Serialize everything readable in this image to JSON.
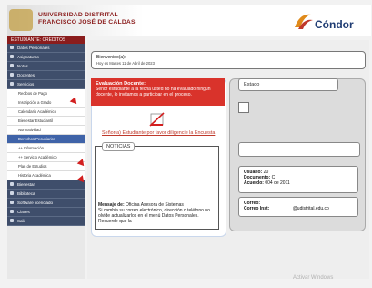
{
  "header": {
    "institution_line1": "UNIVERSIDAD DISTRITAL",
    "institution_line2": "FRANCISCO JOSÉ DE CALDAS",
    "app_name": "Cóndor"
  },
  "sidebar": {
    "title": "ESTUDIANTE: CREDITOS",
    "items": [
      {
        "label": "Datos Personales"
      },
      {
        "label": "Asignaturas"
      },
      {
        "label": "Notas"
      },
      {
        "label": "Docentes"
      },
      {
        "label": "Servicios"
      }
    ],
    "sub_items": [
      {
        "label": "Recibos de Pago"
      },
      {
        "label": "Inscripción a Grado"
      },
      {
        "label": "Calendario Académico"
      },
      {
        "label": "Bienestar Estudiantil"
      },
      {
        "label": "Normatividad"
      },
      {
        "label": "Derechos Pecuniarios",
        "active": true
      },
      {
        "label": "++ Información"
      },
      {
        "label": "++ Servicio Académico"
      },
      {
        "label": "Plan de Estudios"
      },
      {
        "label": "Historia Académica"
      }
    ],
    "bottom_items": [
      {
        "label": "Bienestar"
      },
      {
        "label": "Biblioteca"
      },
      {
        "label": "Software licenciado"
      },
      {
        "label": "Claves"
      },
      {
        "label": "Salir"
      }
    ]
  },
  "welcome": {
    "title": "Bienvenido(a):",
    "date_line": "Hoy es Martes 11 de Abril de 2023"
  },
  "evaluation": {
    "heading": "Evaluación Docente:",
    "body": "Señor estudiante a la fecha usted no ha evaluado ningún docente, lo invitamos a participar en el proceso.",
    "link": "Señor(a) Estudiante por favor diligencie la Encuesta"
  },
  "news": {
    "label": "NOTICIAS",
    "message_label": "Mensaje de:",
    "message_from": "Oficina Asesora de Sistemas",
    "message_body": "Si cambia su correo electrónico, dirección o teléfono no olvide actualizarlos en el menú Datos Personales. Recuerde que la"
  },
  "status": {
    "label": "Estado",
    "user_label": "Usuario:",
    "user_value": "20",
    "doc_label": "Documento:",
    "doc_value": "C",
    "agreement_label": "Acuerdo:",
    "agreement_value": "004 de 2011",
    "email_label": "Correo:",
    "inst_email_label": "Correo Inst:",
    "inst_email_value": "@udistrital.edu.co"
  },
  "watermark": "Activar Windows"
}
